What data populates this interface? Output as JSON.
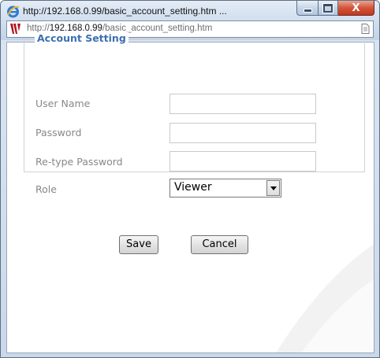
{
  "window": {
    "title": "http://192.168.0.99/basic_account_setting.htm ...",
    "close_glyph": "X"
  },
  "addressbar": {
    "url_prefix": "http://",
    "url_host": "192.168.0.99",
    "url_path": "/basic_account_setting.htm"
  },
  "form": {
    "legend": "Account Setting",
    "fields": {
      "username": {
        "label": "User Name",
        "value": ""
      },
      "password": {
        "label": "Password",
        "value": ""
      },
      "retype_password": {
        "label": "Re-type Password",
        "value": ""
      },
      "role": {
        "label": "Role",
        "selected": "Viewer"
      }
    },
    "buttons": {
      "save": "Save",
      "cancel": "Cancel"
    }
  },
  "icons": {
    "browser": "ie-icon",
    "site": "site-logo-icon",
    "page": "page-icon"
  },
  "colors": {
    "legend": "#3c6fb0",
    "label": "#888888",
    "close_button": "#d4543a"
  }
}
